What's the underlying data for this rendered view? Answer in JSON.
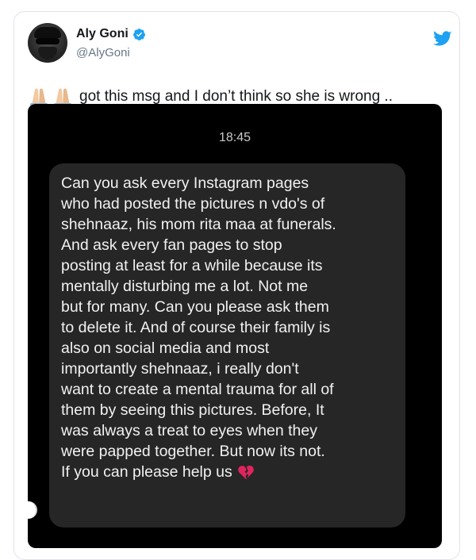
{
  "author": {
    "display_name": "Aly Goni",
    "handle": "@AlyGoni"
  },
  "icons": {
    "verified": "verified-badge-icon",
    "brand": "twitter-bird-icon",
    "emoji": "folded-hands-emoji-icon",
    "heart": "broken-heart-emoji-icon"
  },
  "colors": {
    "twitter_blue": "#1da1f2",
    "screenshot_bg": "#000000",
    "bubble_bg": "#262626"
  },
  "tweet": {
    "text": "got this msg and I don’t think so she is wrong .."
  },
  "screenshot": {
    "time": "18:45",
    "message_lines": [
      "Can you ask every Instagram pages",
      "who had posted the pictures n vdo's of",
      "shehnaaz, his mom rita maa at funerals.",
      "And ask every fan pages to stop",
      "posting at least for a while because its",
      "mentally disturbing me a lot. Not me",
      "but for many. Can you please ask them",
      "to delete it. And of course their family is",
      "also on social media and most",
      "importantly shehnaaz, i really don't",
      "want to create a mental trauma for all of",
      "them by seeing this pictures. Before, It",
      "was always a treat to eyes when they",
      "were papped together. But now its not.",
      "If you can please help us"
    ]
  }
}
